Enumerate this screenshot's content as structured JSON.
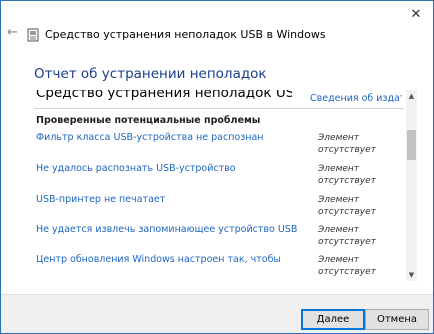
{
  "window": {
    "close_glyph": "✕",
    "back_glyph": "←",
    "title": "Средство устранения неполадок USB в Windows"
  },
  "page": {
    "heading": "Отчет об устранении неполадок"
  },
  "report": {
    "app_name": "Средство устранения неполадок USB в Windows",
    "publisher_link": "Сведения об издателе",
    "section_title": "Проверенные потенциальные проблемы",
    "issues": [
      {
        "label": "Фильтр класса USB-устройства не распознан",
        "status": "Элемент отсутствует"
      },
      {
        "label": "Не удалось распознать USB-устройство",
        "status": "Элемент отсутствует"
      },
      {
        "label": "USB-принтер не печатает",
        "status": "Элемент отсутствует"
      },
      {
        "label": "Не удается извлечь запоминающее устройство USB",
        "status": "Элемент отсутствует"
      },
      {
        "label": "Центр обновления Windows настроен так, чтобы",
        "status": "Элемент отсутствует"
      }
    ]
  },
  "scrollbar": {
    "up_glyph": "▲",
    "down_glyph": "▼"
  },
  "footer": {
    "next_label": "Далее",
    "cancel_label": "Отмена"
  },
  "icons": {
    "back": "back-arrow-icon",
    "app": "troubleshooter-app-icon",
    "close": "close-icon"
  },
  "colors": {
    "heading": "#1a3e8c",
    "link": "#1f66c2",
    "window_border": "#2f6fb5",
    "default_button_border": "#0078d7"
  }
}
